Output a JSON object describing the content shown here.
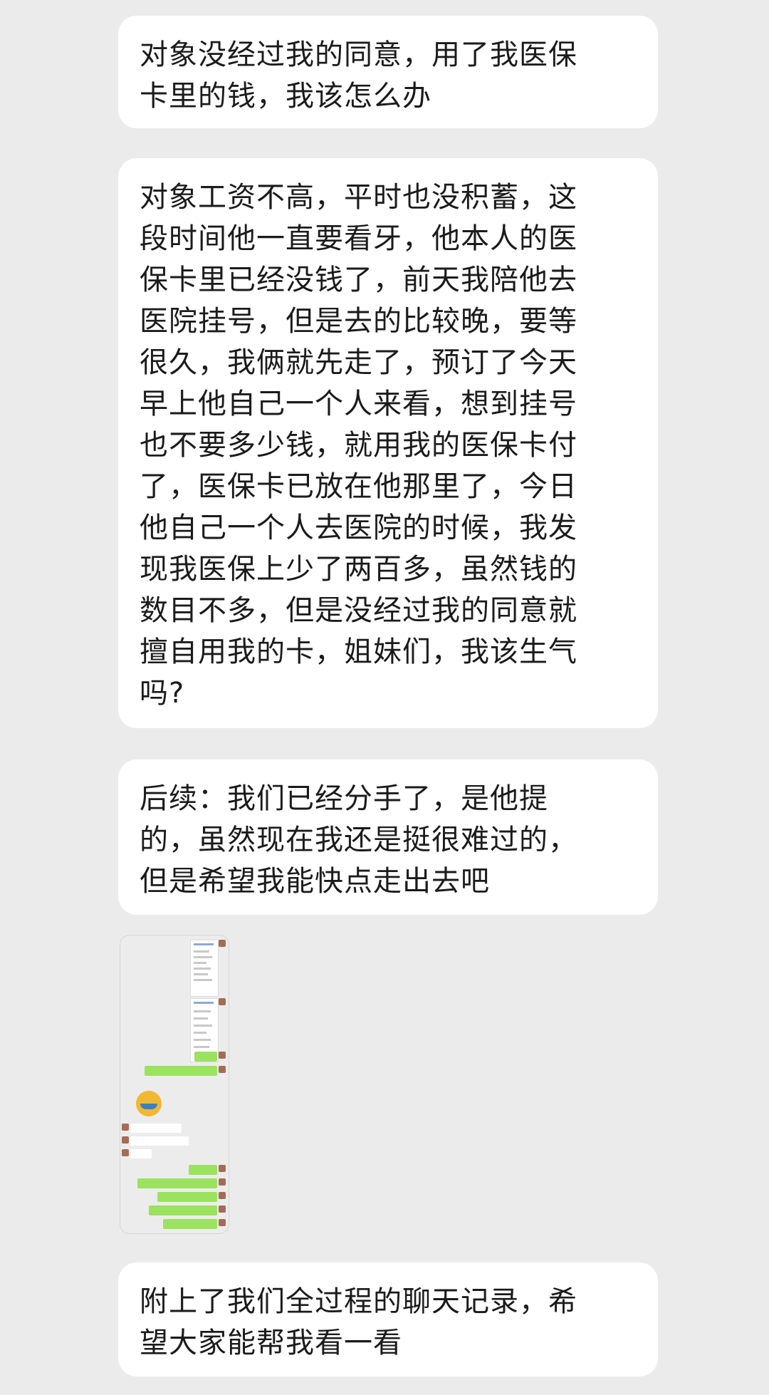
{
  "messages": [
    {
      "text": "对象没经过我的同意，用了我医保\n卡里的钱，我该怎么办"
    },
    {
      "text": "对象工资不高，平时也没积蓄，这\n段时间他一直要看牙，他本人的医\n保卡里已经没钱了，前天我陪他去\n医院挂号，但是去的比较晚，要等\n很久，我俩就先走了，预订了今天\n早上他自己一个人来看，想到挂号\n也不要多少钱，就用我的医保卡付\n了，医保卡已放在他那里了，今日\n他自己一个人去医院的时候，我发\n现我医保上少了两百多，虽然钱的\n数目不多，但是没经过我的同意就\n擅自用我的卡，姐妹们，我该生气\n吗?"
    },
    {
      "text": "后续：我们已经分手了，是他提\n的，虽然现在我还是挺很难过的，\n但是希望我能快点走出去吧"
    },
    {
      "text": "附上了我们全过程的聊天记录，希\n望大家能帮我看一看"
    }
  ],
  "attachment": {
    "type": "chat-screenshot-thumbnail"
  },
  "colors": {
    "background": "#ebebeb",
    "bubble": "#ffffff",
    "text": "#1b1b1b"
  }
}
